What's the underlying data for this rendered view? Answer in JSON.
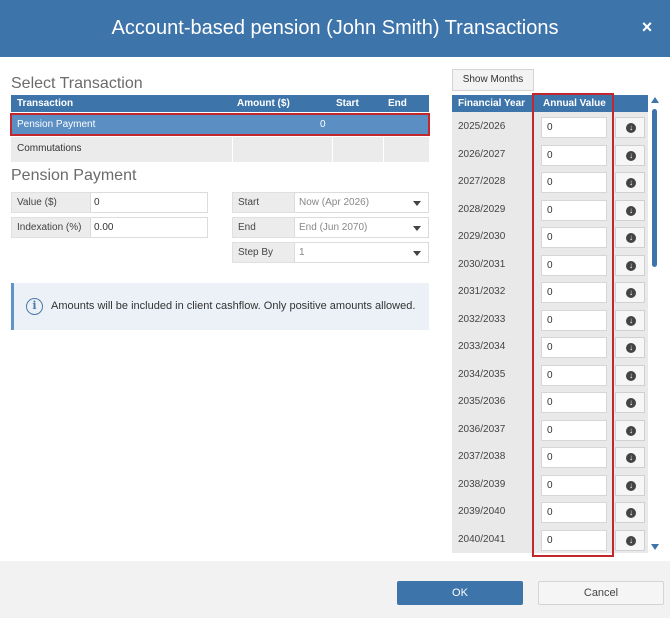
{
  "dialog": {
    "title": "Account-based pension (John Smith) Transactions",
    "close_icon": "×"
  },
  "select_transaction": {
    "heading": "Select Transaction",
    "columns": [
      "Transaction",
      "Amount ($)",
      "Start",
      "End"
    ],
    "rows": [
      {
        "transaction": "Pension Payment",
        "amount": "0",
        "start": "",
        "end": "",
        "selected": true
      },
      {
        "transaction": "Commutations",
        "amount": "",
        "start": "",
        "end": "",
        "selected": false
      }
    ]
  },
  "pension_payment": {
    "heading": "Pension Payment",
    "value_label": "Value ($)",
    "value": "0",
    "indexation_label": "Indexation (%)",
    "indexation": "0.00",
    "start_label": "Start",
    "start_value": "Now (Apr 2026)",
    "end_label": "End",
    "end_value": "End (Jun 2070)",
    "step_label": "Step By",
    "step_value": "1"
  },
  "info": {
    "icon": "info-icon",
    "text": "Amounts will be included in client cashflow. Only positive amounts allowed."
  },
  "annual_panel": {
    "show_months_label": "Show Months",
    "col_year": "Financial Year",
    "col_value": "Annual Value",
    "rows": [
      {
        "year": "2025/2026",
        "value": "0"
      },
      {
        "year": "2026/2027",
        "value": "0"
      },
      {
        "year": "2027/2028",
        "value": "0"
      },
      {
        "year": "2028/2029",
        "value": "0"
      },
      {
        "year": "2029/2030",
        "value": "0"
      },
      {
        "year": "2030/2031",
        "value": "0"
      },
      {
        "year": "2031/2032",
        "value": "0"
      },
      {
        "year": "2032/2033",
        "value": "0"
      },
      {
        "year": "2033/2034",
        "value": "0"
      },
      {
        "year": "2034/2035",
        "value": "0"
      },
      {
        "year": "2035/2036",
        "value": "0"
      },
      {
        "year": "2036/2037",
        "value": "0"
      },
      {
        "year": "2037/2038",
        "value": "0"
      },
      {
        "year": "2038/2039",
        "value": "0"
      },
      {
        "year": "2039/2040",
        "value": "0"
      },
      {
        "year": "2040/2041",
        "value": "0"
      }
    ]
  },
  "footer": {
    "ok_label": "OK",
    "cancel_label": "Cancel"
  },
  "colors": {
    "header_blue": "#3d74aa",
    "selected_row": "#5b8fc4",
    "highlight_red": "#c0282d"
  }
}
